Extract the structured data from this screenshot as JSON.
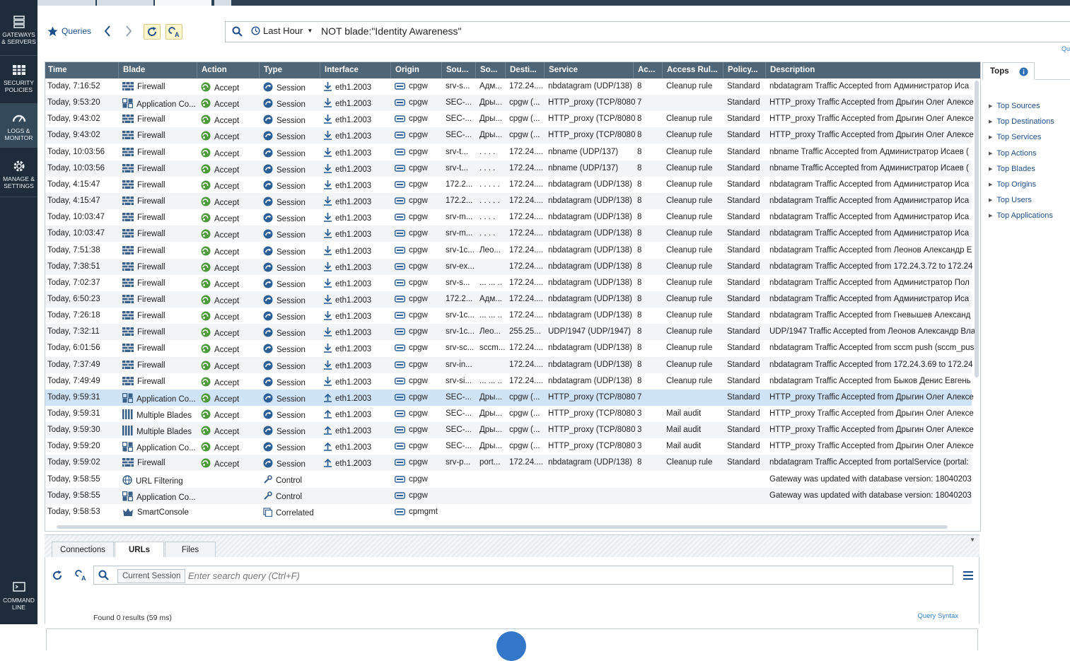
{
  "nav": {
    "items": [
      {
        "label": "GATEWAYS\n& SERVERS",
        "icon": "gateways-icon"
      },
      {
        "label": "SECURITY\nPOLICIES",
        "icon": "policies-icon"
      },
      {
        "label": "LOGS &\nMONITOR",
        "icon": "logs-monitor-icon"
      },
      {
        "label": "MANAGE &\nSETTINGS",
        "icon": "gear-icon"
      },
      {
        "label": "COMMAND\nLINE",
        "icon": "command-line-icon"
      }
    ]
  },
  "toolbar": {
    "queries_label": "Queries",
    "time_filter": "Last Hour",
    "query": "NOT blade:\"Identity Awareness\"",
    "right_link": "Qu"
  },
  "grid": {
    "columns": [
      "Time",
      "Blade",
      "Action",
      "Type",
      "Interface",
      "Origin",
      "Sou...",
      "So...",
      "Desti...",
      "Service",
      "Ac...",
      "Access Rul...",
      "Policy...",
      "Description"
    ],
    "rows": [
      {
        "time": "Today, 7:16:52",
        "blade": "Firewall",
        "bicon": "firewall",
        "action": "Accept",
        "type": "Session",
        "dir": "down",
        "iface": "eth1.2003",
        "origin": "cpgw",
        "src": "srv-s...",
        "so": "Адм...",
        "dst": "172.24....",
        "service": "nbdatagram (UDP/138)",
        "ac": "8",
        "rule": "Cleanup rule",
        "policy": "Standard",
        "desc": "nbdatagram Traffic Accepted from Администратор Иса"
      },
      {
        "time": "Today, 9:53:20",
        "blade": "Application Co...",
        "bicon": "app",
        "action": "Accept",
        "type": "Session",
        "dir": "down",
        "iface": "eth1.2003",
        "origin": "cpgw",
        "src": "SEC-...",
        "so": "Дры...",
        "dst": "cpgw (...",
        "service": "HTTP_proxy (TCP/8080)",
        "ac": "7",
        "rule": "",
        "policy": "Standard",
        "desc": "HTTP_proxy Traffic Accepted from Дрыгин Олег Алексе"
      },
      {
        "time": "Today, 9:43:02",
        "blade": "Firewall",
        "bicon": "firewall",
        "action": "Accept",
        "type": "Session",
        "dir": "down",
        "iface": "eth1.2003",
        "origin": "cpgw",
        "src": "SEC-...",
        "so": "Дры...",
        "dst": "cpgw (...",
        "service": "HTTP_proxy (TCP/8080)",
        "ac": "8",
        "rule": "Cleanup rule",
        "policy": "Standard",
        "desc": "HTTP_proxy Traffic Accepted from Дрыгин Олег Алексе"
      },
      {
        "time": "Today, 9:43:02",
        "blade": "Firewall",
        "bicon": "firewall",
        "action": "Accept",
        "type": "Session",
        "dir": "down",
        "iface": "eth1.2003",
        "origin": "cpgw",
        "src": "SEC-...",
        "so": "Дры...",
        "dst": "cpgw (...",
        "service": "HTTP_proxy (TCP/8080)",
        "ac": "8",
        "rule": "Cleanup rule",
        "policy": "Standard",
        "desc": "HTTP_proxy Traffic Accepted from Дрыгин Олег Алексе"
      },
      {
        "time": "Today, 10:03:56",
        "blade": "Firewall",
        "bicon": "firewall",
        "action": "Accept",
        "type": "Session",
        "dir": "down",
        "iface": "eth1.2003",
        "origin": "cpgw",
        "src": "srv-t...",
        "so": ". . . .",
        "dst": "172.24....",
        "service": "nbname (UDP/137)",
        "ac": "8",
        "rule": "Cleanup rule",
        "policy": "Standard",
        "desc": "nbname Traffic Accepted from Администратор Исаев ("
      },
      {
        "time": "Today, 10:03:56",
        "blade": "Firewall",
        "bicon": "firewall",
        "action": "Accept",
        "type": "Session",
        "dir": "down",
        "iface": "eth1.2003",
        "origin": "cpgw",
        "src": "srv-t...",
        "so": ". . . .",
        "dst": "172.24....",
        "service": "nbname (UDP/137)",
        "ac": "8",
        "rule": "Cleanup rule",
        "policy": "Standard",
        "desc": "nbname Traffic Accepted from Администратор Исаев ("
      },
      {
        "time": "Today, 4:15:47",
        "blade": "Firewall",
        "bicon": "firewall",
        "action": "Accept",
        "type": "Session",
        "dir": "down",
        "iface": "eth1.2003",
        "origin": "cpgw",
        "src": "172.2...",
        "so": ". . . . .",
        "dst": "172.24....",
        "service": "nbdatagram (UDP/138)",
        "ac": "8",
        "rule": "Cleanup rule",
        "policy": "Standard",
        "desc": "nbdatagram Traffic Accepted from Администратор Иса"
      },
      {
        "time": "Today, 4:15:47",
        "blade": "Firewall",
        "bicon": "firewall",
        "action": "Accept",
        "type": "Session",
        "dir": "down",
        "iface": "eth1.2003",
        "origin": "cpgw",
        "src": "172.2...",
        "so": ". . . . .",
        "dst": "172.24....",
        "service": "nbdatagram (UDP/138)",
        "ac": "8",
        "rule": "Cleanup rule",
        "policy": "Standard",
        "desc": "nbdatagram Traffic Accepted from Администратор Иса"
      },
      {
        "time": "Today, 10:03:47",
        "blade": "Firewall",
        "bicon": "firewall",
        "action": "Accept",
        "type": "Session",
        "dir": "down",
        "iface": "eth1.2003",
        "origin": "cpgw",
        "src": "srv-m...",
        "so": ". . . .",
        "dst": "172.24....",
        "service": "nbdatagram (UDP/138)",
        "ac": "8",
        "rule": "Cleanup rule",
        "policy": "Standard",
        "desc": "nbdatagram Traffic Accepted from Администратор Иса"
      },
      {
        "time": "Today, 10:03:47",
        "blade": "Firewall",
        "bicon": "firewall",
        "action": "Accept",
        "type": "Session",
        "dir": "down",
        "iface": "eth1.2003",
        "origin": "cpgw",
        "src": "srv-m...",
        "so": ". . . .",
        "dst": "172.24....",
        "service": "nbdatagram (UDP/138)",
        "ac": "8",
        "rule": "Cleanup rule",
        "policy": "Standard",
        "desc": "nbdatagram Traffic Accepted from Администратор Иса"
      },
      {
        "time": "Today, 7:51:38",
        "blade": "Firewall",
        "bicon": "firewall",
        "action": "Accept",
        "type": "Session",
        "dir": "down",
        "iface": "eth1.2003",
        "origin": "cpgw",
        "src": "srv-1c...",
        "so": "Лео...",
        "dst": "172.24....",
        "service": "nbdatagram (UDP/138)",
        "ac": "8",
        "rule": "Cleanup rule",
        "policy": "Standard",
        "desc": "nbdatagram Traffic Accepted from Леонов Александр Е"
      },
      {
        "time": "Today, 7:38:51",
        "blade": "Firewall",
        "bicon": "firewall",
        "action": "Accept",
        "type": "Session",
        "dir": "down",
        "iface": "eth1.2003",
        "origin": "cpgw",
        "src": "srv-ex...",
        "so": "",
        "dst": "172.24....",
        "service": "nbdatagram (UDP/138)",
        "ac": "8",
        "rule": "Cleanup rule",
        "policy": "Standard",
        "desc": "nbdatagram Traffic Accepted from 172.24.3.72 to 172.24"
      },
      {
        "time": "Today, 7:02:37",
        "blade": "Firewall",
        "bicon": "firewall",
        "action": "Accept",
        "type": "Session",
        "dir": "down",
        "iface": "eth1.2003",
        "origin": "cpgw",
        "src": "srv-s...",
        "so": "... ... ..",
        "dst": "172.24....",
        "service": "nbdatagram (UDP/138)",
        "ac": "8",
        "rule": "Cleanup rule",
        "policy": "Standard",
        "desc": "nbdatagram Traffic Accepted from Администратор Пол"
      },
      {
        "time": "Today, 6:50:23",
        "blade": "Firewall",
        "bicon": "firewall",
        "action": "Accept",
        "type": "Session",
        "dir": "down",
        "iface": "eth1.2003",
        "origin": "cpgw",
        "src": "172.2...",
        "so": "Адм...",
        "dst": "172.24....",
        "service": "nbdatagram (UDP/138)",
        "ac": "8",
        "rule": "Cleanup rule",
        "policy": "Standard",
        "desc": "nbdatagram Traffic Accepted from Администратор Иса"
      },
      {
        "time": "Today, 7:26:18",
        "blade": "Firewall",
        "bicon": "firewall",
        "action": "Accept",
        "type": "Session",
        "dir": "down",
        "iface": "eth1.2003",
        "origin": "cpgw",
        "src": "srv-1c...",
        "so": "... ... ..",
        "dst": "172.24....",
        "service": "nbdatagram (UDP/138)",
        "ac": "8",
        "rule": "Cleanup rule",
        "policy": "Standard",
        "desc": "nbdatagram Traffic Accepted from Гневышев Александ"
      },
      {
        "time": "Today, 7:32:11",
        "blade": "Firewall",
        "bicon": "firewall",
        "action": "Accept",
        "type": "Session",
        "dir": "down",
        "iface": "eth1.2003",
        "origin": "cpgw",
        "src": "srv-1c...",
        "so": "Лео...",
        "dst": "255.25...",
        "service": "UDP/1947 (UDP/1947)",
        "ac": "8",
        "rule": "Cleanup rule",
        "policy": "Standard",
        "desc": "UDP/1947 Traffic Accepted from Леонов Александр Вла"
      },
      {
        "time": "Today, 6:01:56",
        "blade": "Firewall",
        "bicon": "firewall",
        "action": "Accept",
        "type": "Session",
        "dir": "down",
        "iface": "eth1.2003",
        "origin": "cpgw",
        "src": "srv-sc...",
        "so": "sccm...",
        "dst": "172.24....",
        "service": "nbdatagram (UDP/138)",
        "ac": "8",
        "rule": "Cleanup rule",
        "policy": "Standard",
        "desc": "nbdatagram Traffic Accepted from sccm push (sccm_pus"
      },
      {
        "time": "Today, 7:37:49",
        "blade": "Firewall",
        "bicon": "firewall",
        "action": "Accept",
        "type": "Session",
        "dir": "down",
        "iface": "eth1.2003",
        "origin": "cpgw",
        "src": "srv-in...",
        "so": "",
        "dst": "172.24....",
        "service": "nbdatagram (UDP/138)",
        "ac": "8",
        "rule": "Cleanup rule",
        "policy": "Standard",
        "desc": "nbdatagram Traffic Accepted from 172.24.3.69 to 172.24"
      },
      {
        "time": "Today, 7:49:49",
        "blade": "Firewall",
        "bicon": "firewall",
        "action": "Accept",
        "type": "Session",
        "dir": "down",
        "iface": "eth1.2003",
        "origin": "cpgw",
        "src": "srv-si...",
        "so": "... ... ..",
        "dst": "172.24....",
        "service": "nbdatagram (UDP/138)",
        "ac": "8",
        "rule": "Cleanup rule",
        "policy": "Standard",
        "desc": "nbdatagram Traffic Accepted from Быков Денис Евгень"
      },
      {
        "time": "Today, 9:59:31",
        "blade": "Application Co...",
        "bicon": "app",
        "action": "Accept",
        "type": "Session",
        "dir": "up",
        "iface": "eth1.2003",
        "origin": "cpgw",
        "src": "SEC-...",
        "so": "Дры...",
        "dst": "cpgw (...",
        "service": "HTTP_proxy (TCP/8080)",
        "ac": "7",
        "rule": "",
        "policy": "Standard",
        "desc": "HTTP_proxy Traffic Accepted from Дрыгин Олег Алексе",
        "selected": true
      },
      {
        "time": "Today, 9:59:31",
        "blade": "Multiple Blades",
        "bicon": "multi",
        "action": "Accept",
        "type": "Session",
        "dir": "up",
        "iface": "eth1.2003",
        "origin": "cpgw",
        "src": "SEC-...",
        "so": "Дры...",
        "dst": "cpgw (...",
        "service": "HTTP_proxy (TCP/8080)",
        "ac": "3",
        "rule": "Mail audit",
        "policy": "Standard",
        "desc": "HTTP_proxy Traffic Accepted from Дрыгин Олег Алексе"
      },
      {
        "time": "Today, 9:59:30",
        "blade": "Multiple Blades",
        "bicon": "multi",
        "action": "Accept",
        "type": "Session",
        "dir": "up",
        "iface": "eth1.2003",
        "origin": "cpgw",
        "src": "SEC-...",
        "so": "Дры...",
        "dst": "cpgw (...",
        "service": "HTTP_proxy (TCP/8080)",
        "ac": "3",
        "rule": "Mail audit",
        "policy": "Standard",
        "desc": "HTTP_proxy Traffic Accepted from Дрыгин Олег Алексе"
      },
      {
        "time": "Today, 9:59:20",
        "blade": "Application Co...",
        "bicon": "app",
        "action": "Accept",
        "type": "Session",
        "dir": "up",
        "iface": "eth1.2003",
        "origin": "cpgw",
        "src": "SEC-...",
        "so": "Дры...",
        "dst": "cpgw (...",
        "service": "HTTP_proxy (TCP/8080)",
        "ac": "3",
        "rule": "Mail audit",
        "policy": "Standard",
        "desc": "HTTP_proxy Traffic Accepted from Дрыгин Олег Алексе"
      },
      {
        "time": "Today, 9:59:02",
        "blade": "Firewall",
        "bicon": "firewall",
        "action": "Accept",
        "type": "Session",
        "dir": "up",
        "iface": "eth1.2003",
        "origin": "cpgw",
        "src": "srv-p...",
        "so": "port...",
        "dst": "172.24....",
        "service": "nbdatagram (UDP/138)",
        "ac": "8",
        "rule": "Cleanup rule",
        "policy": "Standard",
        "desc": "nbdatagram Traffic Accepted from portalService (portal:"
      },
      {
        "time": "Today, 9:58:55",
        "blade": "URL Filtering",
        "bicon": "url",
        "action": "",
        "type": "Control",
        "dir": "",
        "iface": "",
        "origin": "cpgw",
        "src": "",
        "so": "",
        "dst": "",
        "service": "",
        "ac": "",
        "rule": "",
        "policy": "",
        "desc": "Gateway was updated with database version: 18040203"
      },
      {
        "time": "Today, 9:58:55",
        "blade": "Application Co...",
        "bicon": "app",
        "action": "",
        "type": "Control",
        "dir": "",
        "iface": "",
        "origin": "cpgw",
        "src": "",
        "so": "",
        "dst": "",
        "service": "",
        "ac": "",
        "rule": "",
        "policy": "",
        "desc": "Gateway was updated with database version: 18040203"
      },
      {
        "time": "Today, 9:58:53",
        "blade": "SmartConsole",
        "bicon": "smart",
        "action": "",
        "type": "Correlated",
        "dir": "",
        "iface": "",
        "origin": "cpmgmt",
        "src": "",
        "so": "",
        "dst": "",
        "service": "",
        "ac": "",
        "rule": "",
        "policy": "",
        "desc": ""
      }
    ]
  },
  "tops": {
    "title": "Tops",
    "items": [
      "Top Sources",
      "Top Destinations",
      "Top Services",
      "Top Actions",
      "Top Blades",
      "Top Origins",
      "Top Users",
      "Top Applications"
    ]
  },
  "bottom": {
    "tabs": [
      "Connections",
      "URLs",
      "Files"
    ],
    "session_badge": "Current Session",
    "search_placeholder": "Enter search query (Ctrl+F)",
    "found": "Found 0 results (59 ms)",
    "query_syntax": "Query Syntax"
  },
  "colors": {
    "nav_bg": "#1f2d3a",
    "header_bg": "#4f6678",
    "accent_green": "#4c9a3a",
    "link_blue": "#2f7fc1",
    "selected_row": "#cfe3f7"
  }
}
